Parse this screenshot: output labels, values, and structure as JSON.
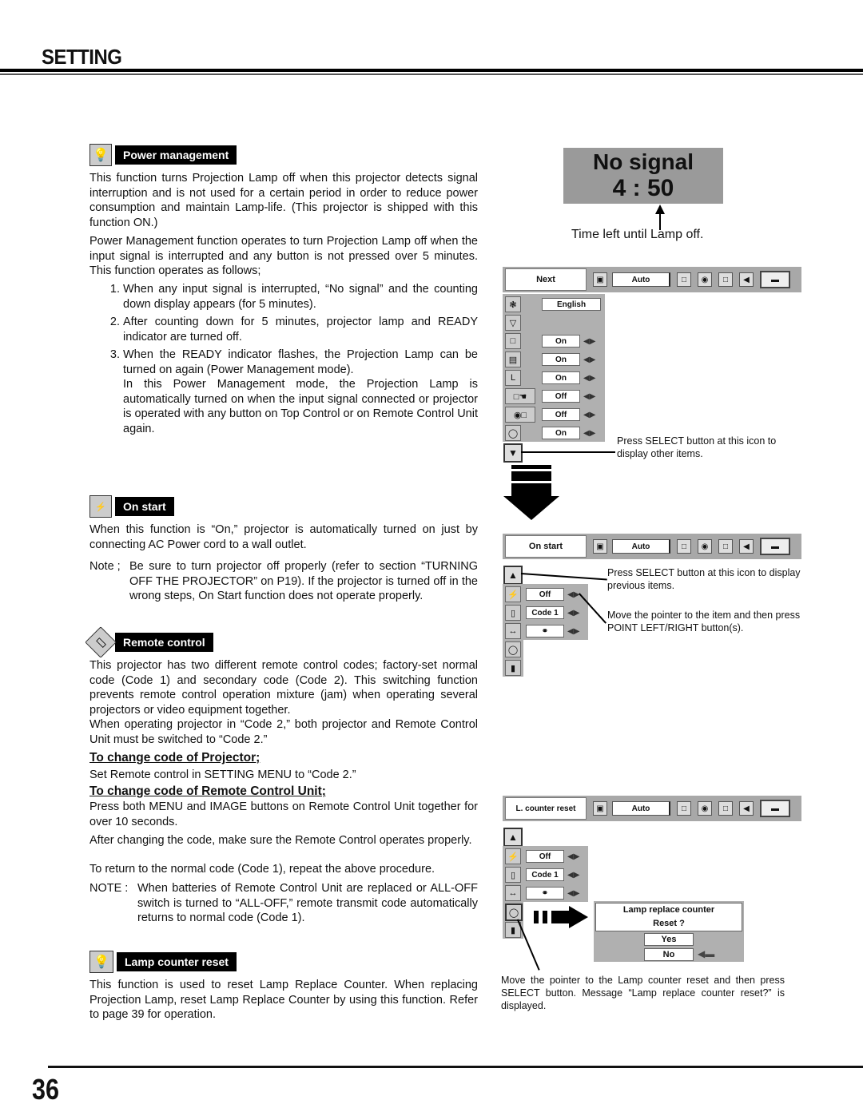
{
  "header": {
    "title": "SETTING"
  },
  "footer": {
    "page_number": "36"
  },
  "power_management": {
    "label": "Power management",
    "icon": "lamp-icon",
    "intro": "This function turns Projection Lamp off when this projector detects signal interruption and is not used for a certain period in order to reduce power consumption and maintain Lamp-life.  (This projector is shipped with this function ON.)",
    "para2": "Power Management function operates to turn Projection Lamp off when the input signal is interrupted and any button is not pressed over 5 minutes. This function operates as follows;",
    "steps": [
      {
        "num": "1.",
        "text": "When any input signal is interrupted, “No signal” and the counting down display appears (for 5 minutes)."
      },
      {
        "num": "2.",
        "text": "After counting down for 5 minutes, projector lamp and READY indicator are turned off."
      },
      {
        "num": "3.",
        "text": "When the READY indicator flashes, the Projection Lamp can be turned on again (Power Management mode)."
      }
    ],
    "step3_extra": "In this Power Management mode, the Projection Lamp is automatically turned on when the input signal connected or projector is operated with any button on Top Control or on Remote Control Unit again."
  },
  "on_start": {
    "label": "On start",
    "icon": "power-plug-icon",
    "text": "When this function is “On,” projector is automatically turned on just by connecting AC Power cord to a wall outlet.",
    "note_label": "Note ;",
    "note_text": "Be sure to turn projector off properly (refer to section “TURNING OFF THE PROJECTOR” on P19).  If the projector is turned off in the wrong steps, On Start function does not operate properly."
  },
  "remote_control": {
    "label": "Remote control",
    "icon": "remote-icon",
    "text1": "This projector has two different remote control codes; factory-set normal code (Code 1) and secondary code (Code 2).  This switching function prevents remote control operation mixture (jam) when operating several projectors or video equipment together.",
    "text2": "When operating projector in “Code 2,”  both projector and Remote Control Unit must be switched to “Code 2.”",
    "sub1_title": "To change code of Projector;",
    "sub1_text": "Set Remote control in SETTING MENU to “Code 2.”",
    "sub2_title": "To change code of Remote Control Unit;",
    "sub2_text": "Press both MENU and IMAGE buttons on Remote Control Unit together for over 10 seconds.",
    "after1": "After changing the code, make sure the Remote Control operates properly.",
    "after2": "To return to the normal code (Code 1), repeat the above procedure.",
    "note_label": "NOTE :",
    "note_text": "When batteries of Remote Control Unit are replaced or ALL-OFF switch is turned to “ALL-OFF,” remote transmit code automatically returns to normal code (Code 1)."
  },
  "lamp_counter_reset": {
    "label": "Lamp counter reset",
    "icon": "lamp-reset-icon",
    "text": "This function is used to reset Lamp Replace Counter.  When replacing Projection Lamp, reset Lamp Replace Counter by using this function.  Refer to page 39 for operation."
  },
  "no_signal_display": {
    "line1": "No signal",
    "time": "4 : 50",
    "caption": "Time left until Lamp off."
  },
  "menu1": {
    "tab": "Next",
    "auto": "Auto",
    "rows": [
      {
        "icon": "language-icon",
        "value": "English",
        "arrows": false
      },
      {
        "icon": "keystone-icon",
        "value": "",
        "arrows": false
      },
      {
        "icon": "blue-back-icon",
        "value": "On",
        "arrows": true
      },
      {
        "icon": "display-icon",
        "value": "On",
        "arrows": true
      },
      {
        "icon": "logo-icon",
        "value": "On",
        "arrows": true
      },
      {
        "icon": "ceiling-icon",
        "value": "Off",
        "arrows": true
      },
      {
        "icon": "rear-icon",
        "value": "Off",
        "arrows": true
      },
      {
        "icon": "power-management-icon",
        "value": "On",
        "arrows": true
      }
    ],
    "callout": "Press SELECT button at this icon to display other items."
  },
  "menu2": {
    "tab": "On start",
    "auto": "Auto",
    "rows": [
      {
        "icon": "on-start-icon",
        "value": "Off"
      },
      {
        "icon": "remote-control-icon",
        "value": "Code 1"
      },
      {
        "icon": "pointer-icon",
        "value": ""
      }
    ],
    "callout_prev": "Press SELECT button at this icon to display previous items.",
    "callout_move": "Move the pointer to the item and then press POINT LEFT/RIGHT button(s)."
  },
  "menu3": {
    "tab": "L. counter reset",
    "auto": "Auto",
    "rows": [
      {
        "icon": "on-start-icon",
        "value": "Off"
      },
      {
        "icon": "remote-control-icon",
        "value": "Code 1"
      },
      {
        "icon": "pointer-icon",
        "value": ""
      }
    ],
    "dialog": {
      "title": "Lamp replace counter",
      "question": "Reset ?",
      "yes": "Yes",
      "no": "No"
    },
    "callout": "Move the pointer to the Lamp counter reset and then press SELECT button.  Message “Lamp replace counter reset?” is displayed."
  }
}
